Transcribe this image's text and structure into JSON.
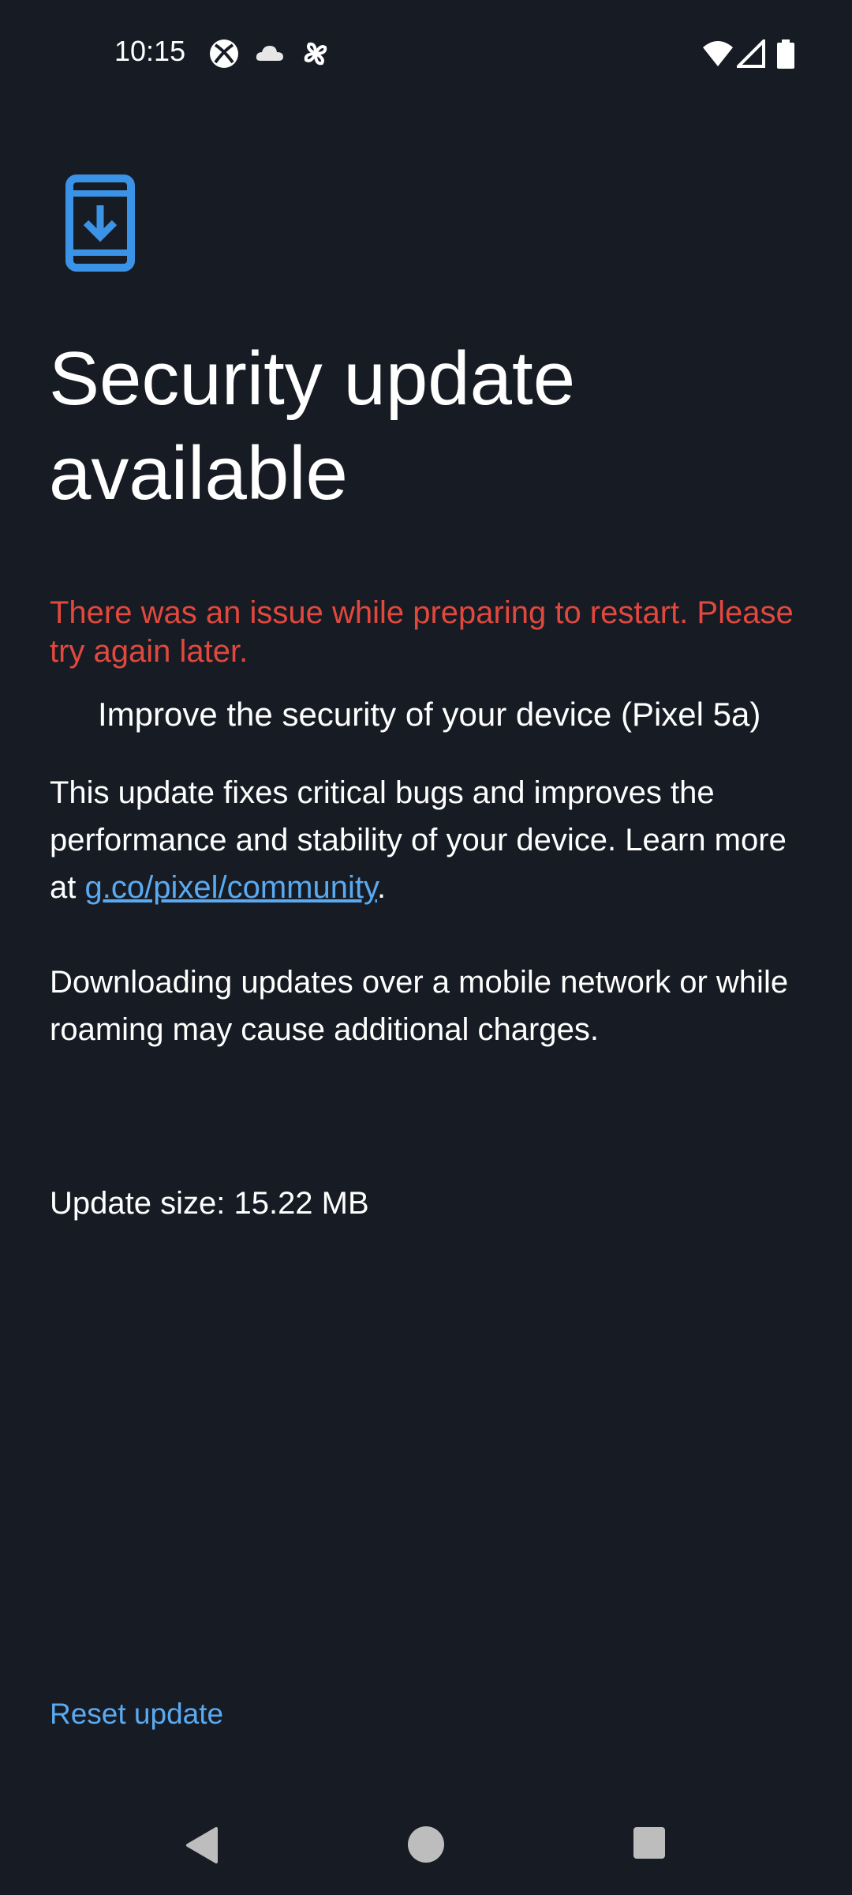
{
  "status_bar": {
    "time": "10:15",
    "icons": [
      "xbox-icon",
      "cloud-icon",
      "pinwheel-icon",
      "wifi-icon",
      "signal-icon",
      "battery-icon"
    ]
  },
  "header": {
    "icon": "phone-download-icon",
    "title": "Security update available"
  },
  "error_message": "There was an issue while preparing to restart. Please try again later.",
  "subtitle": "Improve the security of your device (Pixel 5a)",
  "description": {
    "text_before_link": "This update fixes critical bugs and improves the performance and stability of your device. Learn more at ",
    "link_text": "g.co/pixel/community",
    "text_after_link": "."
  },
  "charges_notice": "Downloading updates over a mobile network or while roaming may cause additional charges.",
  "update_size": "Update size: 15.22 MB",
  "actions": {
    "reset_label": "Reset update"
  },
  "nav": {
    "icons": [
      "back-icon",
      "home-icon",
      "recents-icon"
    ]
  },
  "colors": {
    "background": "#171c24",
    "accent": "#5aaaf2",
    "error": "#e2483d",
    "text": "#ffffff"
  }
}
